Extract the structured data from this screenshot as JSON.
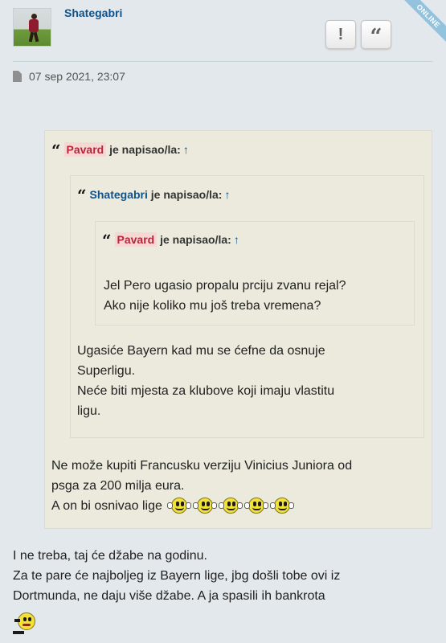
{
  "post": {
    "username": "Shategabri",
    "status": "ONLINE",
    "date": "07 sep 2021, 23:07",
    "buttons": {
      "report": "!",
      "quote": "“"
    },
    "icons": {
      "report": "exclamation-icon",
      "quote": "quote-icon",
      "date": "document-icon"
    }
  },
  "quote_outer": {
    "author": "Pavard",
    "suffix": "je napisao/la:",
    "arrow": "↑",
    "lines": [
      "Ne može kupiti Francusku verziju Vinicius Juniora od",
      "psga za 200 milja eura.",
      "A on bi osnivao lige"
    ],
    "smiley_count": 5
  },
  "quote_middle": {
    "author": "Shategabri",
    "suffix": "je napisao/la:",
    "arrow": "↑",
    "lines": [
      "Ugasiće Bayern kad mu se ćefne da osnuje",
      "Superligu.",
      "Neće biti mjesta za klubove koji imaju vlastitu",
      "ligu."
    ]
  },
  "quote_inner": {
    "author": "Pavard",
    "suffix": "je napisao/la:",
    "arrow": "↑",
    "lines": [
      "Jel Pero ugasio propalu prciju zvanu rejal?",
      "Ako nije koliko mu još treba vremena?"
    ]
  },
  "body": {
    "lines": [
      "I ne treba, taj će džabe na godinu.",
      "Za te pare će najboljeg iz Bayern lige, jbg došli tobe ovi iz",
      "Dortmunda, ne daju više džabe. A ja spasili ih bankrota"
    ]
  },
  "colors": {
    "username": "#105289",
    "quote_bg": "#ebeadd",
    "author_highlight_bg": "#f7d7d3",
    "author_highlight_text": "#b5263b",
    "online_ribbon": "#93c2dd",
    "page_bg": "#e3e8ec"
  }
}
